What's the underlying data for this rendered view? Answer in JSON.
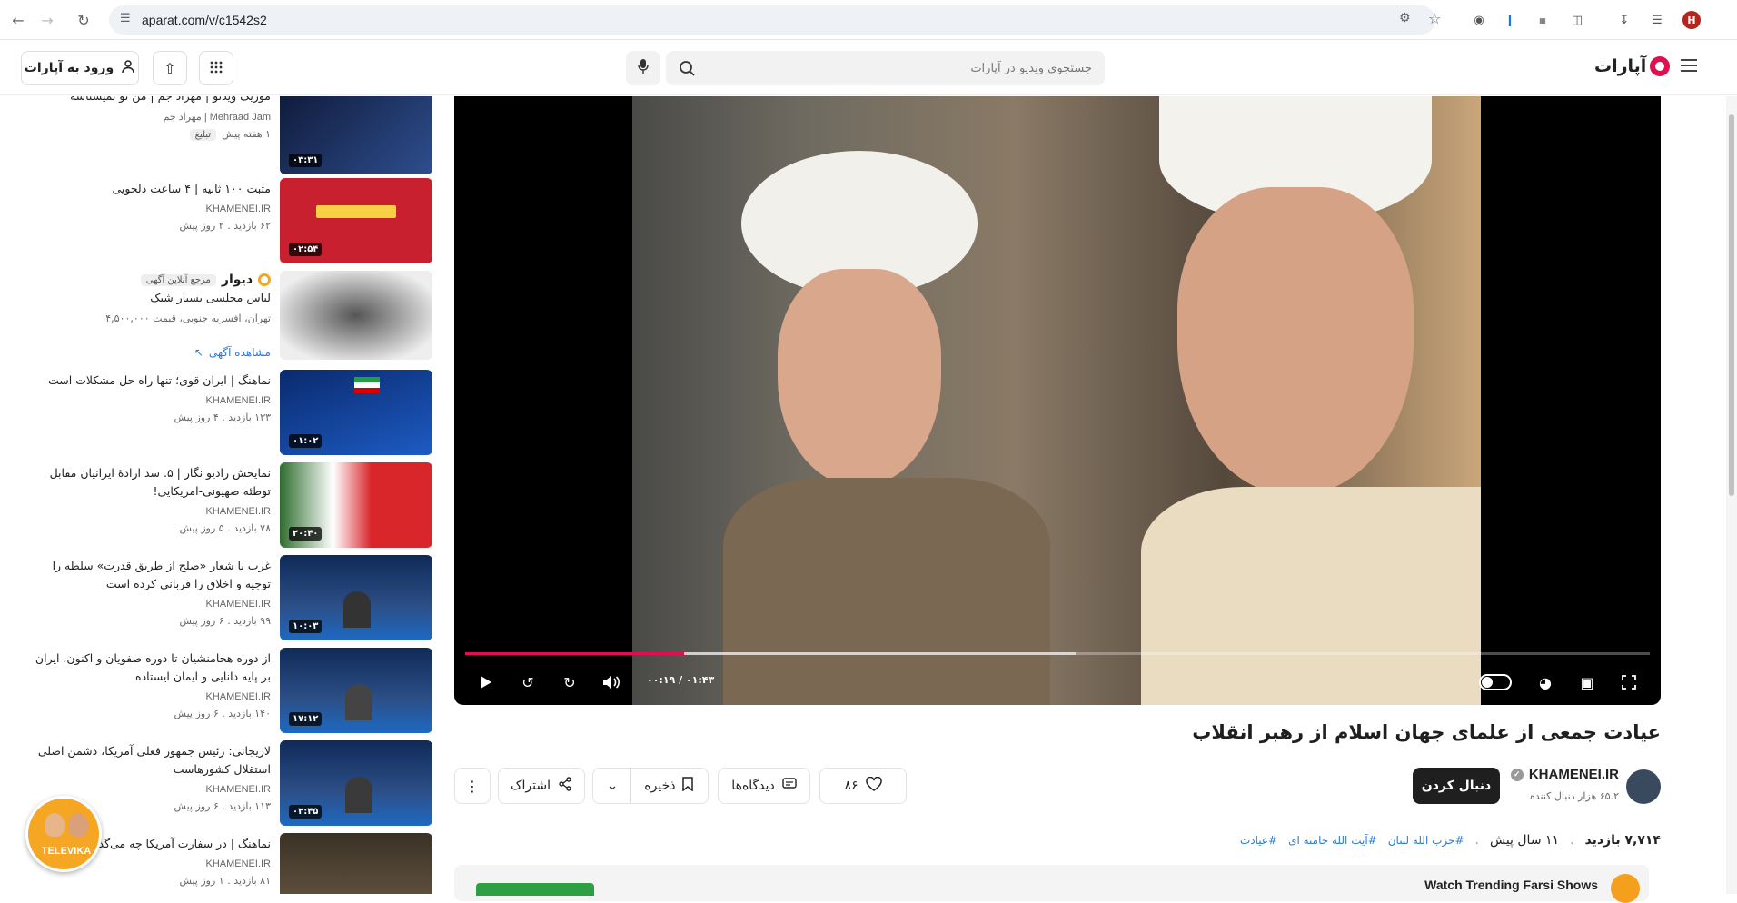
{
  "browser": {
    "url": "aparat.com/v/c1542s2",
    "profile_initial": "H"
  },
  "header": {
    "login_label": "ورود به آپارات",
    "search_placeholder": "جستجوی ویدیو در آپارات",
    "logo_text": "آپارات"
  },
  "sidebar": {
    "items": [
      {
        "title": "موزیک ویدئو | مهراد جم | من تو نمیشناسه",
        "channel": "Mehraad Jam | مهراد جم",
        "meta": "۱ هفته پیش",
        "tag": "تبلیغ",
        "duration": "۰۳:۳۱",
        "thumb_color": "#1d2a4f"
      },
      {
        "title": "مثبت ۱۰۰ ثانیه | ۴ ساعت دلجویی",
        "channel": "KHAMENEI.IR",
        "meta": "۶۲ بازدید . ۲ روز پیش",
        "duration": "۰۲:۵۴",
        "thumb_color": "#c8202e"
      },
      {
        "ad_brand": "دیوار",
        "ad_badge": "مرجع آنلاین آگهی",
        "title": "لباس مجلسی بسیار شیک",
        "meta": "تهران، افسریه جنوبی، قیمت ۴,۵۰۰,۰۰۰",
        "ad_link": "مشاهده آگهی",
        "thumb_color": "#888888"
      },
      {
        "title": "نماهنگ | ایران قوی؛ تنها راه حل مشکلات است",
        "channel": "KHAMENEI.IR",
        "meta": "۱۳۳ بازدید . ۴ روز پیش",
        "duration": "۰۱:۰۲",
        "thumb_color": "#0d3a8c"
      },
      {
        "title": "نمایخش رادیو نگار | ۵. سد ارادهٔ ایرانیان مقابل توطئه صهیونی-امریکایی!",
        "channel": "KHAMENEI.IR",
        "meta": "۷۸ بازدید . ۵ روز پیش",
        "duration": "۲۰:۴۰",
        "thumb_color": "#d8262b"
      },
      {
        "title": "غرب با شعار «صلح از طریق قدرت» سلطه را توجیه و اخلاق را قربانی کرده است",
        "channel": "KHAMENEI.IR",
        "meta": "۹۹ بازدید . ۶ روز پیش",
        "duration": "۱۰:۰۳",
        "thumb_color": "#1b3b6f"
      },
      {
        "title": "از دوره هخامنشیان تا دوره صفویان و اکنون، ایران بر پایه دانایی و ایمان ایستاده",
        "channel": "KHAMENEI.IR",
        "meta": "۱۴۰ بازدید . ۶ روز پیش",
        "duration": "۱۷:۱۲",
        "thumb_color": "#1b3b6f"
      },
      {
        "title": "لاریجانی: رئیس جمهور فعلی آمریکا، دشمن اصلی استقلال کشورهاست",
        "channel": "KHAMENEI.IR",
        "meta": "۱۱۳ بازدید . ۶ روز پیش",
        "duration": "۰۲:۴۵",
        "thumb_color": "#1b3b6f"
      },
      {
        "title": "نماهنگ | در سفارت آمریکا چه می‌گذشت؟",
        "channel": "KHAMENEI.IR",
        "meta": "۸۱ بازدید . ۱ روز پیش",
        "duration": "",
        "thumb_color": "#3a3126"
      }
    ]
  },
  "player": {
    "time_display": "۰۰:۱۹ / ۰۱:۴۳",
    "progress": 0.185,
    "buffered": 0.515
  },
  "video": {
    "title": "عیادت جمعی از علمای جهان اسلام از رهبر انقلاب",
    "channel_name": "KHAMENEI.IR",
    "subscribers": "۶۵.۲ هزار دنبال کننده",
    "follow_label": "دنبال کردن",
    "likes": "۸۶",
    "comments_label": "دیدگاه‌ها",
    "save_label": "ذخیره",
    "share_label": "اشتراک",
    "views": "۷,۷۱۴ بازدید",
    "age": "۱۱ سال پیش",
    "hashtags": [
      "#حزب الله لبنان",
      "#آیت الله خامنه ای",
      "#عیادت"
    ]
  },
  "promo": {
    "title": "Watch Trending Farsi Shows"
  },
  "badge": {
    "label": "TELEVIKA"
  },
  "colors": {
    "brand": "#df0f50",
    "link": "#2b7bd6"
  }
}
